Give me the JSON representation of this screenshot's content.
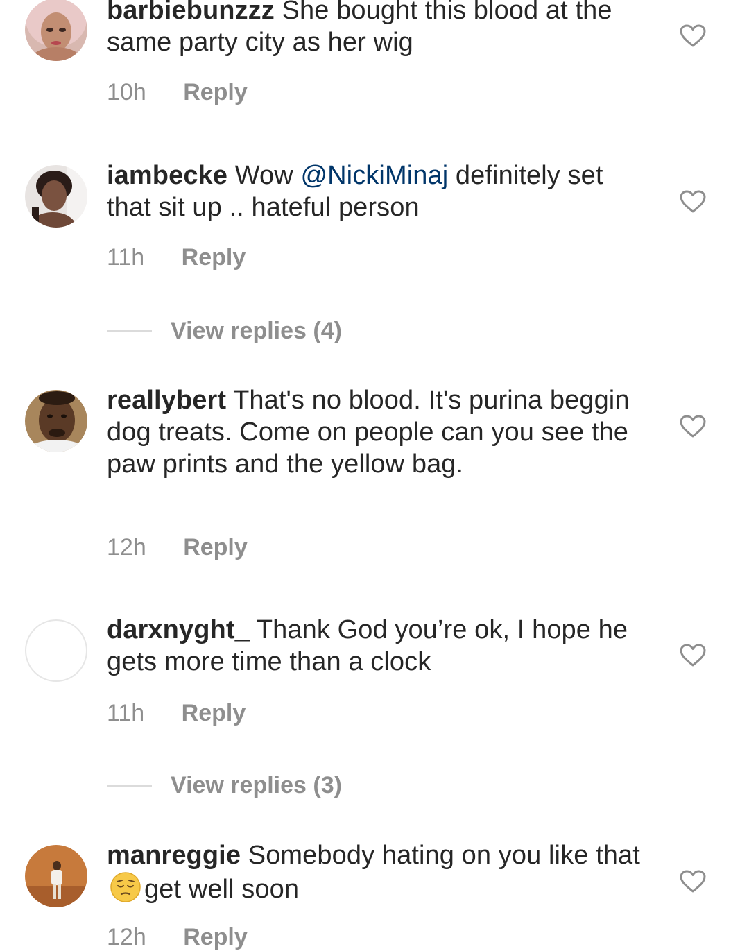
{
  "comments": [
    {
      "username": "barbiebunzzz",
      "text": "She bought this blood at the same party city as her wig",
      "time": "10h",
      "reply_label": "Reply"
    },
    {
      "username": "iambecke",
      "text_before": "Wow",
      "mention": "@NickiMinaj",
      "text_after": "definitely set that sit up .. hateful person",
      "time": "11h",
      "reply_label": "Reply",
      "view_replies": "View replies (4)"
    },
    {
      "username": "reallybert",
      "text": "That's no blood. It's purina beggin  dog treats. Come on people can you see the paw prints and the yellow bag.",
      "time": "12h",
      "reply_label": "Reply"
    },
    {
      "username": "darxnyght_",
      "text": "Thank God you’re ok, I hope he gets more time than a clock",
      "time": "11h",
      "reply_label": "Reply",
      "view_replies": "View replies (3)"
    },
    {
      "username": "manreggie",
      "text_before": "Somebody hating on you like that",
      "emoji": "pensive-face-emoji",
      "text_after": "get well soon",
      "time": "12h",
      "reply_label": "Reply"
    }
  ],
  "icons": {
    "like": "heart-outline-icon"
  },
  "colors": {
    "text": "#262626",
    "meta": "#8e8e8e",
    "mention": "#003569",
    "divider": "#dbdbdb"
  }
}
